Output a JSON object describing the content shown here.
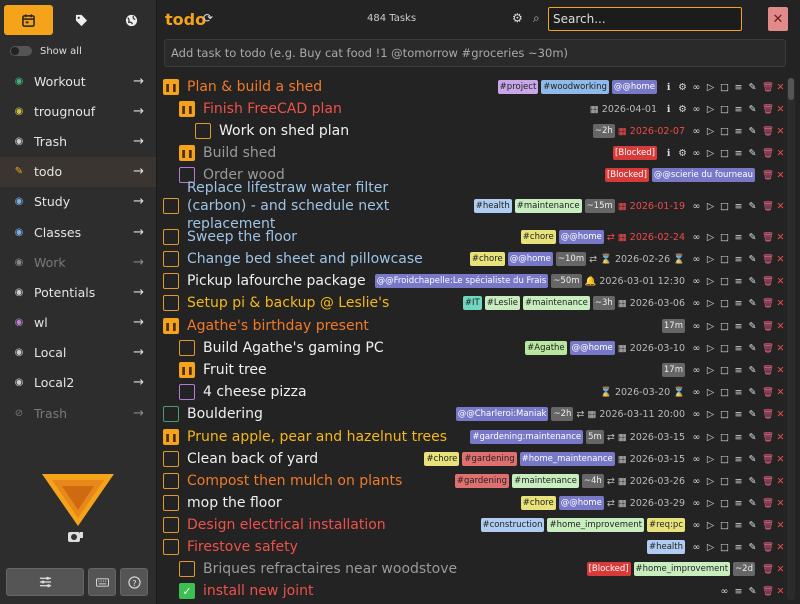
{
  "sidebar": {
    "show_all_label": "Show all",
    "items": [
      {
        "label": "Workout",
        "icon": "eye-icon",
        "icon_color": "#3fb07a",
        "dim": false
      },
      {
        "label": "trougnouf",
        "icon": "eye-icon",
        "icon_color": "#c8c040",
        "dim": false
      },
      {
        "label": "Trash",
        "icon": "eye-icon",
        "icon_color": "#cccccc",
        "dim": false
      },
      {
        "label": "todo",
        "icon": "edit-icon",
        "icon_color": "#f5a31a",
        "dim": false,
        "active": true
      },
      {
        "label": "Study",
        "icon": "eye-icon",
        "icon_color": "#7ab0e0",
        "dim": false
      },
      {
        "label": "Classes",
        "icon": "eye-icon",
        "icon_color": "#7ab0e0",
        "dim": false
      },
      {
        "label": "Work",
        "icon": "eye-icon",
        "icon_color": "#888888",
        "dim": true
      },
      {
        "label": "Potentials",
        "icon": "eye-icon",
        "icon_color": "#cccccc",
        "dim": false
      },
      {
        "label": "wl",
        "icon": "eye-icon",
        "icon_color": "#c080d0",
        "dim": false
      },
      {
        "label": "Local",
        "icon": "eye-icon",
        "icon_color": "#cccccc",
        "dim": false
      },
      {
        "label": "Local2",
        "icon": "eye-icon",
        "icon_color": "#cccccc",
        "dim": false
      },
      {
        "label": "Trash",
        "icon": "eye-slash-icon",
        "icon_color": "#777777",
        "dim": true
      }
    ]
  },
  "header": {
    "title": "todo",
    "count": "484 Tasks",
    "search_placeholder": "Search...",
    "add_placeholder": "Add task to todo (e.g. Buy cat food !1 @tomorrow #groceries ~30m)"
  },
  "tasks": [
    {
      "name": "Plan & build a shed",
      "indent": 0,
      "cb": "paused",
      "color": "c-orange",
      "tags": [
        [
          "#project",
          "t-purple"
        ],
        [
          "#woodworking",
          "t-blue"
        ],
        [
          "@@home",
          "t-lav"
        ]
      ],
      "date": "",
      "icons": "info"
    },
    {
      "name": "Finish FreeCAD plan",
      "indent": 1,
      "cb": "paused",
      "color": "c-red",
      "tags": [],
      "date": "▦ 2026-04-01",
      "overdue": false,
      "icons": "info"
    },
    {
      "name": "Work on shed plan",
      "indent": 2,
      "cb": "orange",
      "color": "c-white",
      "tags": [
        [
          "~2h",
          "dur"
        ]
      ],
      "date": "▦ 2026-02-07",
      "overdue": true,
      "icons": "std"
    },
    {
      "name": "Build shed",
      "indent": 1,
      "cb": "paused",
      "color": "c-grey",
      "tags": [
        [
          "[Blocked]",
          "t-red"
        ]
      ],
      "date": "",
      "icons": "info"
    },
    {
      "name": "Order wood",
      "indent": 1,
      "cb": "purple",
      "color": "c-grey",
      "tags": [
        [
          "[Blocked]",
          "t-red"
        ],
        [
          "@@scierie du fourneau",
          "t-lav"
        ]
      ],
      "date": "",
      "icons": "none"
    },
    {
      "name": "Replace lifestraw water filter (carbon) - and schedule next replacement",
      "indent": 0,
      "cb": "orange",
      "color": "c-blue",
      "two": true,
      "tags": [
        [
          "#health",
          "t-sky"
        ],
        [
          "#maintenance",
          "t-lgreen"
        ],
        [
          "~15m",
          "dur"
        ]
      ],
      "date": "▦ 2026-01-19",
      "overdue": true,
      "icons": "std"
    },
    {
      "name": "Sweep the floor",
      "indent": 0,
      "cb": "orange",
      "color": "c-blue",
      "tags": [
        [
          "#chore",
          "t-yellow"
        ],
        [
          "@@home",
          "t-lav"
        ]
      ],
      "date": "⇄ ▦ 2026-02-24",
      "overdue": true,
      "icons": "std"
    },
    {
      "name": "Change bed sheet and pillowcase",
      "indent": 0,
      "cb": "orange",
      "color": "c-blue",
      "tags": [
        [
          "#chore",
          "t-yellow"
        ],
        [
          "@@home",
          "t-lav"
        ],
        [
          "~10m",
          "dur"
        ]
      ],
      "date": "⇄ ⌛ 2026-02-26 ⌛",
      "overdue": false,
      "icons": "std"
    },
    {
      "name": "Pickup lafourche package",
      "indent": 0,
      "cb": "orange",
      "color": "c-white",
      "tags": [
        [
          "@@Froidchapelle:Le spécialiste du Frais",
          "t-lav"
        ],
        [
          "~50m",
          "dur"
        ]
      ],
      "date": "🔔 2026-03-01 12:30",
      "overdue": false,
      "icons": "std"
    },
    {
      "name": "Setup pi & backup @ Leslie's",
      "indent": 0,
      "cb": "orange",
      "color": "c-yellow",
      "tags": [
        [
          "#IT",
          "t-teal"
        ],
        [
          "#Leslie",
          "t-lgreen"
        ],
        [
          "#maintenance",
          "t-lgreen"
        ],
        [
          "~3h",
          "dur"
        ]
      ],
      "date": "▦ 2026-03-06",
      "overdue": false,
      "icons": "std"
    },
    {
      "name": "Agathe's birthday present",
      "indent": 0,
      "cb": "paused",
      "color": "c-orange",
      "tags": [
        [
          "17m",
          "dur"
        ]
      ],
      "date": "",
      "icons": "std"
    },
    {
      "name": "Build Agathe's gaming PC",
      "indent": 1,
      "cb": "orange",
      "color": "c-white",
      "tags": [
        [
          "#Agathe",
          "t-green"
        ],
        [
          "@@home",
          "t-lav"
        ]
      ],
      "date": "▦ 2026-03-10",
      "overdue": false,
      "icons": "std"
    },
    {
      "name": "Fruit tree",
      "indent": 1,
      "cb": "paused",
      "color": "c-white",
      "tags": [
        [
          "17m",
          "dur"
        ]
      ],
      "date": "",
      "icons": "std"
    },
    {
      "name": "4 cheese pizza",
      "indent": 1,
      "cb": "purple",
      "color": "c-white",
      "tags": [],
      "date": "⌛ 2026-03-20 ⌛",
      "overdue": false,
      "icons": "std"
    },
    {
      "name": "Bouldering",
      "indent": 0,
      "cb": "green",
      "color": "c-white",
      "tags": [
        [
          "@@Charleroi:Maniak",
          "t-lav"
        ],
        [
          "~2h",
          "dur"
        ]
      ],
      "date": "⇄ ▦ 2026-03-11 20:00",
      "overdue": false,
      "icons": "std"
    },
    {
      "name": "Prune apple, pear and hazelnut trees",
      "indent": 0,
      "cb": "paused",
      "color": "c-yellow",
      "tags": [
        [
          "#gardening:maintenance",
          "t-lav"
        ],
        [
          "5m",
          "dur"
        ]
      ],
      "date": "⇄ ▦ 2026-03-15",
      "overdue": false,
      "icons": "std"
    },
    {
      "name": "Clean back of yard",
      "indent": 0,
      "cb": "orange",
      "color": "c-white",
      "tags": [
        [
          "#chore",
          "t-yellow"
        ],
        [
          "#gardening",
          "t-pink"
        ],
        [
          "#home_maintenance",
          "t-lav"
        ]
      ],
      "date": "▦ 2026-03-15",
      "overdue": false,
      "icons": "std"
    },
    {
      "name": "Compost then mulch on plants",
      "indent": 0,
      "cb": "orange",
      "color": "c-orange",
      "tags": [
        [
          "#gardening",
          "t-pink"
        ],
        [
          "#maintenance",
          "t-lgreen"
        ],
        [
          "~4h",
          "dur"
        ]
      ],
      "date": "⇄ ▦ 2026-03-26",
      "overdue": false,
      "icons": "std"
    },
    {
      "name": "mop the floor",
      "indent": 0,
      "cb": "orange",
      "color": "c-white",
      "tags": [
        [
          "#chore",
          "t-yellow"
        ],
        [
          "@@home",
          "t-lav"
        ]
      ],
      "date": "⇄ ▦ 2026-03-29",
      "overdue": false,
      "icons": "std"
    },
    {
      "name": "Design electrical installation",
      "indent": 0,
      "cb": "orange",
      "color": "c-red",
      "tags": [
        [
          "#construction",
          "t-sky"
        ],
        [
          "#home_improvement",
          "t-lgreen"
        ],
        [
          "#req:pc",
          "t-yellow"
        ]
      ],
      "date": "",
      "icons": "std"
    },
    {
      "name": "Firestove safety",
      "indent": 0,
      "cb": "orange",
      "color": "c-red",
      "tags": [
        [
          "#health",
          "t-sky"
        ]
      ],
      "date": "",
      "icons": "std"
    },
    {
      "name": "Briques refractaires near woodstove",
      "indent": 1,
      "cb": "orange",
      "color": "c-grey",
      "tags": [
        [
          "[Blocked]",
          "t-red"
        ],
        [
          "#home_improvement",
          "t-lgreen"
        ],
        [
          "~2d",
          "dur"
        ]
      ],
      "date": "",
      "icons": "none"
    },
    {
      "name": "install new joint",
      "indent": 1,
      "cb": "done",
      "color": "c-red",
      "tags": [],
      "date": "",
      "icons": "done"
    }
  ]
}
